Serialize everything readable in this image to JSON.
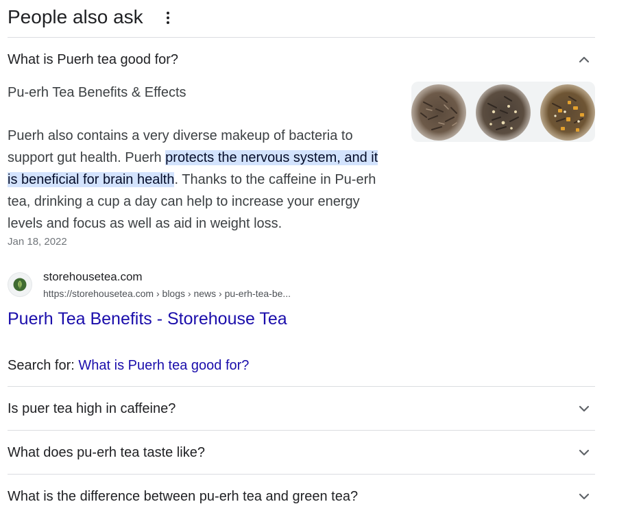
{
  "header": {
    "title": "People also ask",
    "more_icon": "more-vert-icon"
  },
  "expanded": {
    "question": "What is Puerh tea good for?",
    "toggle_icon": "chevron-up-icon",
    "answer_heading": "Pu-erh Tea Benefits & Effects",
    "snippet": {
      "part1": "Puerh also contains a very diverse makeup of bacteria to support gut health. Puerh ",
      "highlight": "protects the nervous system, and it is beneficial for brain health",
      "part2": ". Thanks to the caffeine in Pu-erh tea, drinking a cup a day can help to increase your energy levels and focus as well as aid in weight loss."
    },
    "date": "Jan 18, 2022",
    "image_icon": "tea-leaves-image",
    "source": {
      "site_name": "storehousetea.com",
      "url": "https://storehousetea.com › blogs › news › pu-erh-tea-be...",
      "favicon_icon": "storehouse-tea-favicon-icon",
      "title": "Puerh Tea Benefits - Storehouse Tea"
    },
    "search_for": {
      "label": "Search for: ",
      "query": "What is Puerh tea good for?"
    }
  },
  "questions": [
    {
      "text": "Is puer tea high in caffeine?",
      "icon": "chevron-down-icon"
    },
    {
      "text": "What does pu-erh tea taste like?",
      "icon": "chevron-down-icon"
    },
    {
      "text": "What is the difference between pu-erh tea and green tea?",
      "icon": "chevron-down-icon"
    }
  ],
  "colors": {
    "link": "#1a0dab",
    "highlight": "#d3e3fd",
    "divider": "#dadce0",
    "text": "#202124",
    "secondary_text": "#3c4043"
  }
}
